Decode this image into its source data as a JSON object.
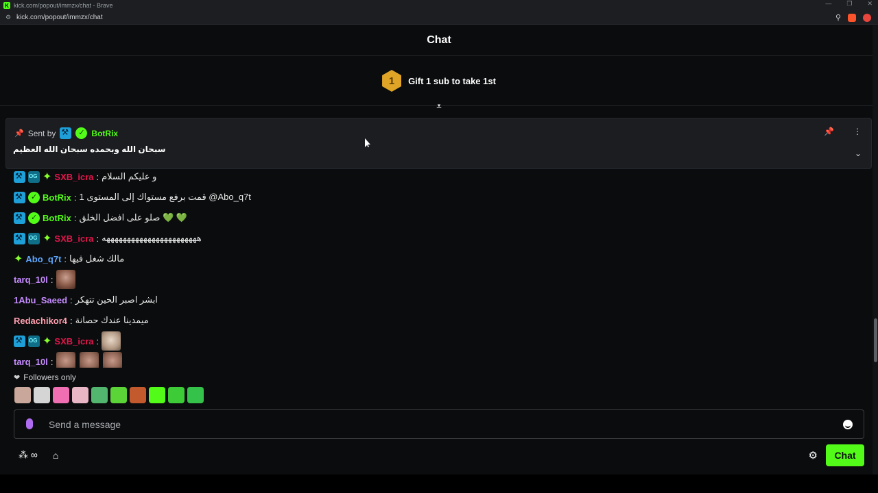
{
  "browser": {
    "title": "kick.com/popout/immzx/chat - Brave",
    "url": "kick.com/popout/immzx/chat"
  },
  "chat": {
    "header": "Chat",
    "gift_rank": "1",
    "gift_text": "Gift 1 sub to take 1st",
    "pinned": {
      "sent_by_label": "Sent by",
      "author": "BotRix",
      "text": "سبحان الله وبحمده سبحان الله العظيم"
    },
    "messages": [
      {
        "user": "SXB_icra",
        "color": "#e3174d",
        "text": "و عليكم السلام",
        "badges": [
          "mod-icon",
          "og-icon",
          "sparkle-icon"
        ]
      },
      {
        "user": "BotRix",
        "color": "#53fc18",
        "text": "قمت برفع مستواك إلى المستوى 1 @Abo_q7t",
        "badges": [
          "mod-icon",
          "verified-icon"
        ]
      },
      {
        "user": "BotRix",
        "color": "#53fc18",
        "text": "صلو على افضل الخلق 💚 💚",
        "badges": [
          "mod-icon",
          "verified-icon"
        ]
      },
      {
        "user": "SXB_icra",
        "color": "#e3174d",
        "text": "هههههههههههههههههههههههه",
        "badges": [
          "mod-icon",
          "og-icon",
          "sparkle-icon"
        ]
      },
      {
        "user": "Abo_q7t",
        "color": "#5fa8ff",
        "text": "مالك شغل فيها",
        "badges": [
          "sparkle-icon"
        ]
      },
      {
        "user": "tarq_10l",
        "color": "#c58cff",
        "text": "",
        "badges": []
      },
      {
        "user": "1Abu_Saeed",
        "color": "#c58cff",
        "text": "ابشر اصبر الحين تتهكر",
        "badges": []
      },
      {
        "user": "Redachikor4",
        "color": "#ff9fb0",
        "text": "ميمدينا عندك حصانة",
        "badges": []
      },
      {
        "user": "SXB_icra",
        "color": "#e3174d",
        "text": "",
        "badges": [
          "mod-icon",
          "og-icon",
          "sparkle-icon"
        ]
      },
      {
        "user": "tarq_10l",
        "color": "#c58cff",
        "text": "",
        "badges": []
      }
    ],
    "followers_only": "Followers only",
    "input_placeholder": "Send a message",
    "send_button": "Chat"
  },
  "colors": {
    "accent": "#53fc18",
    "background": "#0b0c0d"
  }
}
